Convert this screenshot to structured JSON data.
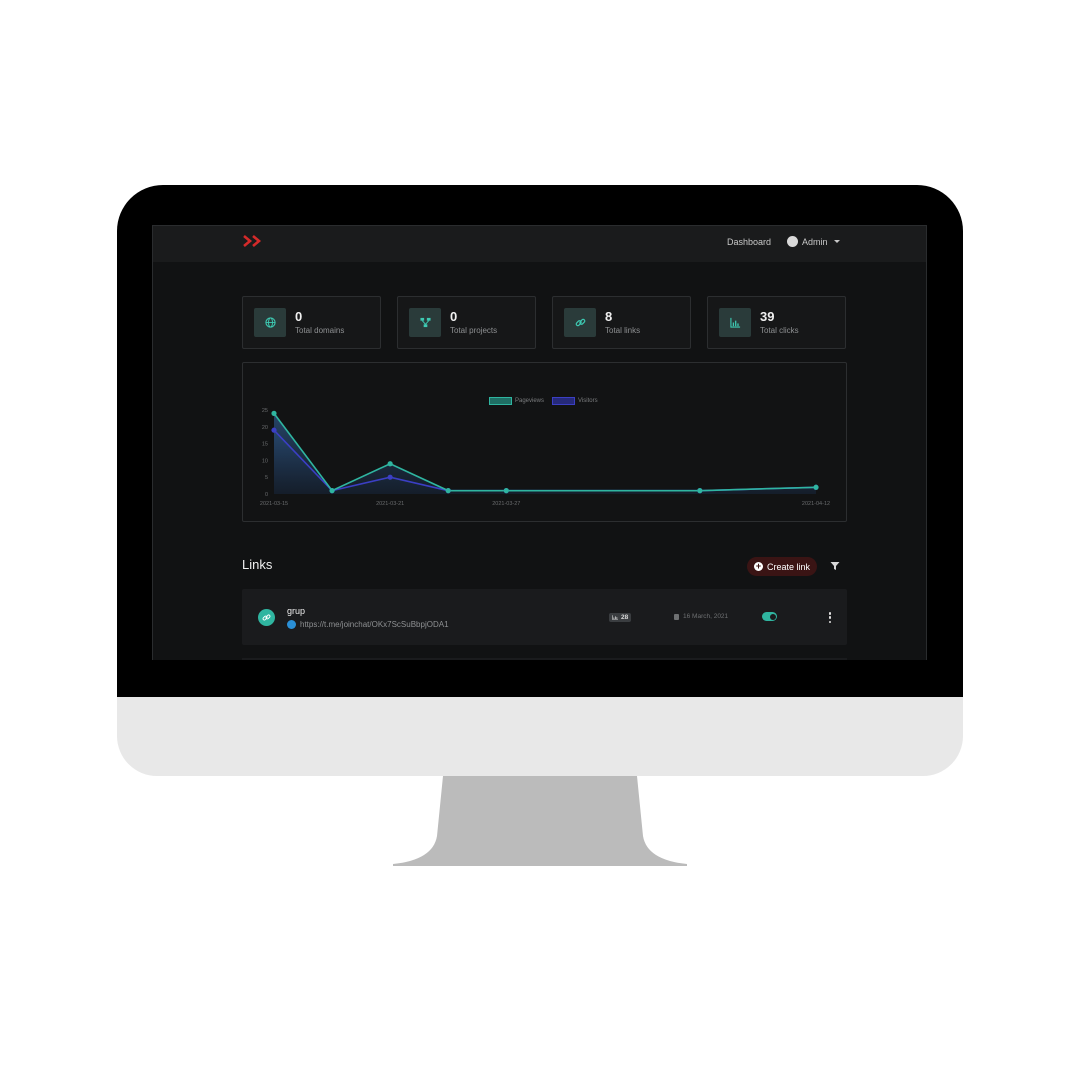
{
  "nav": {
    "dashboard_label": "Dashboard",
    "admin_label": "Admin"
  },
  "stats": [
    {
      "value": "0",
      "label": "Total domains",
      "icon": "globe-icon"
    },
    {
      "value": "0",
      "label": "Total projects",
      "icon": "project-tree-icon"
    },
    {
      "value": "8",
      "label": "Total links",
      "icon": "link-icon"
    },
    {
      "value": "39",
      "label": "Total clicks",
      "icon": "bar-chart-icon"
    }
  ],
  "colors": {
    "accent": "#2fb5a0",
    "visitors": "#3b3fc4",
    "brand_red": "#d42a2a",
    "create_btn_bg": "#3a1414"
  },
  "chart_data": {
    "type": "area",
    "x": [
      "2021-03-15",
      "2021-03-18",
      "2021-03-21",
      "2021-03-24",
      "2021-03-27",
      "2021-04-06",
      "2021-04-12"
    ],
    "x_tick_labels": [
      "2021-03-15",
      "2021-03-21",
      "2021-03-27",
      "2021-04-12"
    ],
    "series": [
      {
        "name": "Pageviews",
        "values": [
          24,
          1,
          9,
          1,
          1,
          1,
          2
        ]
      },
      {
        "name": "Visitors",
        "values": [
          19,
          1,
          5,
          1,
          1,
          1,
          2
        ]
      }
    ],
    "ylim": [
      0,
      25
    ],
    "y_ticks": [
      0,
      5,
      10,
      15,
      20,
      25
    ],
    "legend_position": "top-center",
    "grid": false
  },
  "links_section": {
    "title": "Links",
    "create_label": "Create link"
  },
  "links": [
    {
      "name": "grup",
      "url": "https://t.me/joinchat/OKx7ScSuBbpjODA1",
      "clicks": "28",
      "date": "16 March, 2021",
      "enabled": true
    }
  ]
}
